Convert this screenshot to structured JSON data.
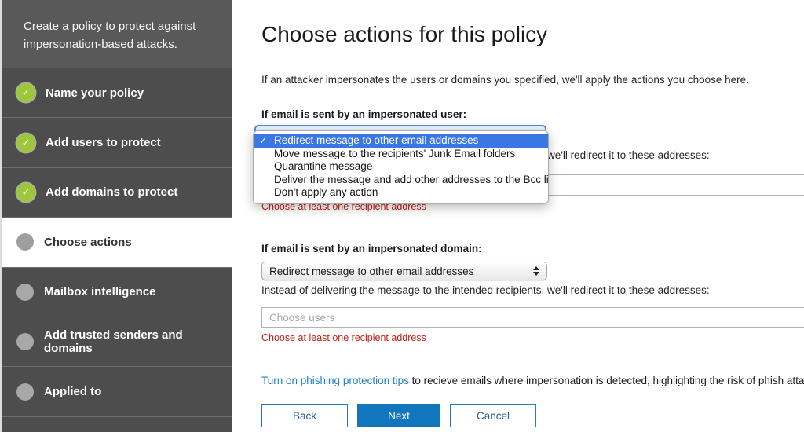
{
  "icons": {
    "check": "✓"
  },
  "colors": {
    "sidebar_bg": "#4d4d4d",
    "sidebar_header_bg": "#595959",
    "step_complete_green": "#9dc73b",
    "step_pending_gray": "#a8a8a8",
    "active_step_bg": "#ffffff",
    "menu_selection_blue": "#3b77e3",
    "primary_button_blue": "#1176bc",
    "error_red": "#c2201a",
    "link_blue": "#2180c4"
  },
  "sidebar": {
    "intro": "Create a policy to protect against impersonation-based attacks.",
    "steps": [
      {
        "label": "Name your policy",
        "state": "complete"
      },
      {
        "label": "Add users to protect",
        "state": "complete"
      },
      {
        "label": "Add domains to protect",
        "state": "complete"
      },
      {
        "label": "Choose actions",
        "state": "active"
      },
      {
        "label": "Mailbox intelligence",
        "state": "pending"
      },
      {
        "label": "Add trusted senders and domains",
        "state": "pending"
      },
      {
        "label": "Applied to",
        "state": "pending"
      }
    ]
  },
  "main": {
    "title": "Choose actions for this policy",
    "intro": "If an attacker impersonates the users or domains you specified, we'll apply the actions you choose here.",
    "user_section": {
      "label": "If email is sent by an impersonated user:",
      "redirect_note": "Instead of delivering the message to the intended recipients, we'll redirect it to these addresses:",
      "input_value": "",
      "error": "Choose at least one recipient address"
    },
    "dropdown": {
      "options": [
        "Redirect message to other email addresses",
        "Move message to the recipients' Junk Email folders",
        "Quarantine message",
        "Deliver the message and add other addresses to the Bcc line",
        "Don't apply any action"
      ],
      "selected_index_label": "Redirect message to other email addresses"
    },
    "domain_section": {
      "label": "If email is sent by an impersonated domain:",
      "selected": "Redirect message to other email addresses",
      "redirect_note": "Instead of delivering the message to the intended recipients, we'll redirect it to these addresses:",
      "placeholder": "Choose users",
      "error": "Choose at least one recipient address"
    },
    "footer": {
      "link": "Turn on phishing protection tips",
      "text": " to recieve emails where impersonation is detected, highlighting the risk of phish attack."
    },
    "buttons": {
      "back": "Back",
      "next": "Next",
      "cancel": "Cancel"
    }
  }
}
